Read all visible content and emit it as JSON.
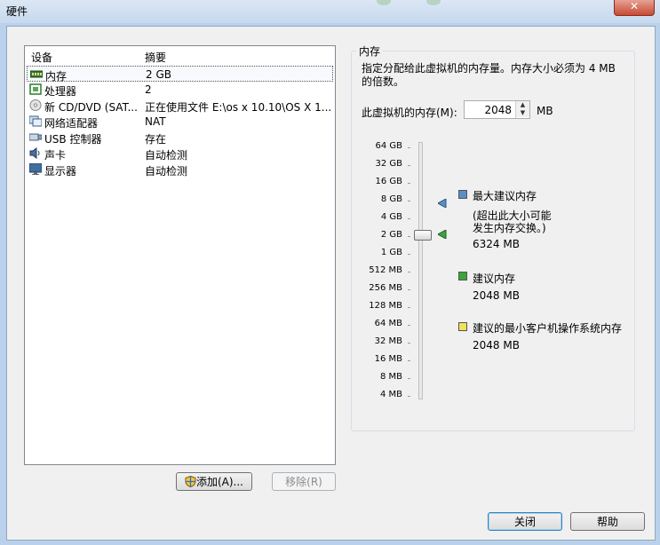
{
  "window": {
    "title": "硬件",
    "close_glyph": "✕"
  },
  "device_list": {
    "col_device": "设备",
    "col_summary": "摘要",
    "rows": [
      {
        "name": "内存",
        "summary": "2 GB",
        "icon": "memory-icon",
        "selected": true
      },
      {
        "name": "处理器",
        "summary": "2",
        "icon": "processor-icon",
        "selected": false
      },
      {
        "name": "新 CD/DVD (SAT...",
        "summary": "正在使用文件 E:\\os x 10.10\\OS X 1...",
        "icon": "cd-dvd-icon",
        "selected": false
      },
      {
        "name": "网络适配器",
        "summary": "NAT",
        "icon": "network-adapter-icon",
        "selected": false
      },
      {
        "name": "USB 控制器",
        "summary": "存在",
        "icon": "usb-icon",
        "selected": false
      },
      {
        "name": "声卡",
        "summary": "自动检测",
        "icon": "sound-card-icon",
        "selected": false
      },
      {
        "name": "显示器",
        "summary": "自动检测",
        "icon": "monitor-icon",
        "selected": false
      }
    ]
  },
  "buttons": {
    "add": "添加(A)...",
    "remove": "移除(R)",
    "close": "关闭",
    "help": "帮助"
  },
  "memory": {
    "group_title": "内存",
    "description": "指定分配给此虚拟机的内存量。内存大小必须为 4 MB 的倍数。",
    "field_label": "此虚拟机的内存(M):",
    "value": "2048",
    "unit": "MB",
    "scale_labels": [
      "64 GB",
      "32 GB",
      "16 GB",
      "8 GB",
      "4 GB",
      "2 GB",
      "1 GB",
      "512 MB",
      "256 MB",
      "128 MB",
      "64 MB",
      "32 MB",
      "16 MB",
      "8 MB",
      "4 MB"
    ],
    "slider_value": "2 GB",
    "legend": {
      "max_title": "最大建议内存",
      "max_note_1": "(超出此大小可能",
      "max_note_2": "发生内存交换。)",
      "max_value": "6324 MB",
      "rec_title": "建议内存",
      "rec_value": "2048 MB",
      "min_title": "建议的最小客户机操作系统内存",
      "min_value": "2048 MB"
    },
    "colors": {
      "max": "#5b8fc6",
      "recommended": "#3aa63a",
      "minimum": "#f2e15a"
    }
  }
}
